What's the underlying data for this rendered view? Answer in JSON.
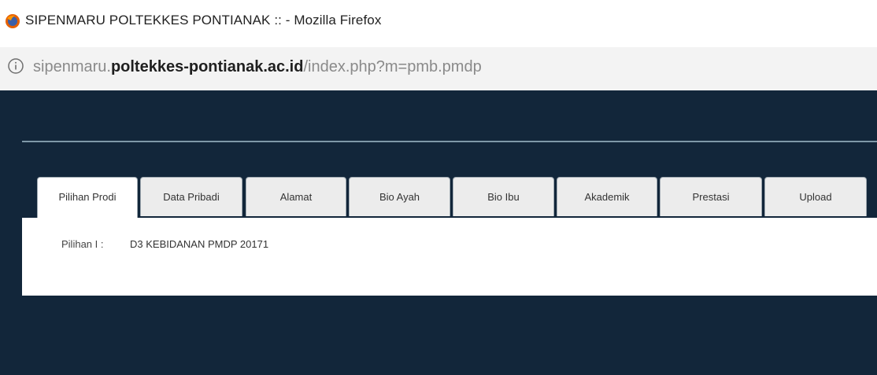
{
  "window": {
    "title": "SIPENMARU POLTEKKES PONTIANAK :: - Mozilla Firefox",
    "icon": "firefox-icon"
  },
  "urlbar": {
    "icon": "info-icon",
    "url_prefix": "sipenmaru.",
    "url_domain": "poltekkes-pontianak.ac.id",
    "url_path": "/index.php?m=pmb.pmdp"
  },
  "tabs": [
    {
      "label": "Pilihan Prodi",
      "active": true
    },
    {
      "label": "Data Pribadi",
      "active": false
    },
    {
      "label": "Alamat",
      "active": false
    },
    {
      "label": "Bio Ayah",
      "active": false
    },
    {
      "label": "Bio Ibu",
      "active": false
    },
    {
      "label": "Akademik",
      "active": false
    },
    {
      "label": "Prestasi",
      "active": false
    },
    {
      "label": "Upload",
      "active": false
    }
  ],
  "content": {
    "pilihan_label": "Pilihan I :",
    "pilihan_value": "D3 KEBIDANAN PMDP 20171"
  },
  "colors": {
    "page_background": "#12263a",
    "header_line": "#7f98a8",
    "tab_background": "#ececec",
    "panel_background": "#ffffff"
  }
}
